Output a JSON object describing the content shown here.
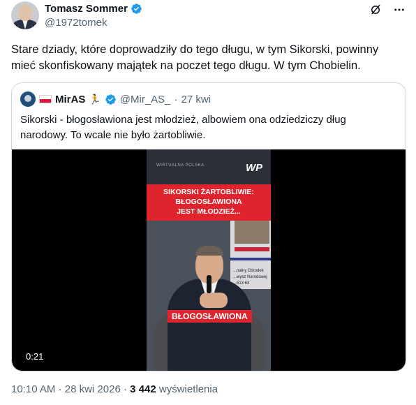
{
  "author": {
    "name": "Tomasz Sommer",
    "handle": "@1972tomek",
    "verified_color": "#1d9bf0"
  },
  "header_icons": [
    "grok-icon",
    "more-icon"
  ],
  "tweet": {
    "text_line1": "Stare dziady, które doprowadziły do tego długu, w tym Sikorski, powinny",
    "text_line2": "mieć skonfiskowany majątek na poczet tego długu. W tym Chobielin."
  },
  "quote": {
    "name": "MirAS",
    "emoji": "🏃",
    "handle": "@Mir_AS_",
    "separator": "·",
    "time": "27 kwi",
    "text_line1": "Sikorski - błogosławiona jest młodzież, albowiem ona odziedziczy dług",
    "text_line2": "narodowy. To wcale nie było żartobliwie.",
    "video": {
      "banner_line1": "SIKORSKI ŻARTOBLIWIE:",
      "banner_line2": "BŁOGOSŁAWIONA",
      "banner_line3": "JEST MŁODZIEŻ...",
      "caption": "BŁOGOSŁAWIONA",
      "logo": "WP",
      "watermark": "WIRTUALNA POLSKA",
      "poster_lines": [
        "...nalny Ośrodek",
        "...wysz Narodowej",
        "...513 63"
      ],
      "duration": "0:21",
      "banner_color": "#e0242d"
    }
  },
  "meta": {
    "time": "10:10 AM",
    "dot": "·",
    "date": "28 kwi 2026",
    "views_count": "3 442",
    "views_label": "wyświetlenia"
  }
}
